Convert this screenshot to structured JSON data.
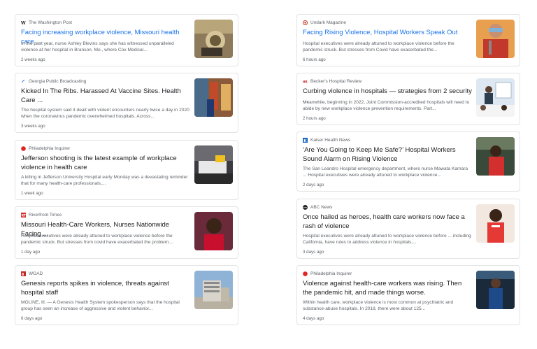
{
  "left_articles": [
    {
      "source": "The Washington Post",
      "headline": "Facing increasing workplace violence, Missouri health care ...",
      "snippet": "In the past year, nurse Ashley Blevins says she has witnessed unparalleled violence at her hospital in Branson, Mo., where Cox Medical...",
      "age": "2 weeks ago"
    },
    {
      "source": "Georgia Public Broadcasting",
      "headline": "Kicked In The Ribs. Harassed At Vaccine Sites. Health Care ...",
      "snippet": "The hospital system said it dealt with violent encounters nearly twice a day in 2020 when the coronavirus pandemic overwhelmed hospitals. Across...",
      "age": "3 weeks ago"
    },
    {
      "source": "Philadelphia Inquirer",
      "headline": "Jefferson shooting is the latest example of workplace violence in health care",
      "snippet": "A killing in Jefferson University Hospital early Monday was a devastating reminder that for many health-care professionals,...",
      "age": "1 week ago"
    },
    {
      "source": "Riverfront Times",
      "headline": "Missouri Health-Care Workers, Nurses Nationwide Facing ...",
      "snippet": "Hospital executives were already attuned to workplace violence before the pandemic struck. But stresses from covid have exacerbated the problem....",
      "age": "1 day ago"
    },
    {
      "source": "WGAD",
      "headline": "Genesis reports spikes in violence, threats against hospital staff",
      "snippet": "MOLINE, Ill. — A Genesis Health System spokesperson says that the hospital group has seen an increase of aggressive and violent behavior...",
      "age": "6 days ago"
    }
  ],
  "right_articles": [
    {
      "source": "Undark Magazine",
      "headline": "Facing Rising Violence, Hospital Workers Speak Out",
      "snippet": "Hospital executives were already attuned to workplace violence before the pandemic struck. But stresses from Covid have exacerbated the...",
      "age": "6 hours ago"
    },
    {
      "source": "Becker's Hospital Review",
      "headline": "Curbing violence in hospitals — strategies from 2 security ...",
      "snippet": "Meanwhile, beginning in 2022, Joint Commission-accredited hospitals will need to abide by new workplace violence prevention requirements. Part...",
      "age": "2 hours ago"
    },
    {
      "source": "Kaiser Health News",
      "headline": "‘Are You Going to Keep Me Safe?’ Hospital Workers Sound Alarm on Rising Violence",
      "snippet": "The San Leandro Hospital emergency department, where nurse Mawata Kamara ... Hospital executives were already attuned to workplace violence...",
      "age": "2 days ago"
    },
    {
      "source": "ABC News",
      "headline": "Once hailed as heroes, health care workers now face a rash of violence",
      "snippet": "Hospital executives were already attuned to workplace violence before ... including California, have rules to address violence in hospitals,...",
      "age": "3 days ago"
    },
    {
      "source": "Philadelphia Inquirer",
      "headline": "Violence against health-care workers was rising. Then the pandemic hit, and made things worse.",
      "snippet": "Within health care, workplace violence is most common at psychiatric and substance-abuse hospitals. In 2018, there were about 125...",
      "age": "4 days ago"
    }
  ]
}
